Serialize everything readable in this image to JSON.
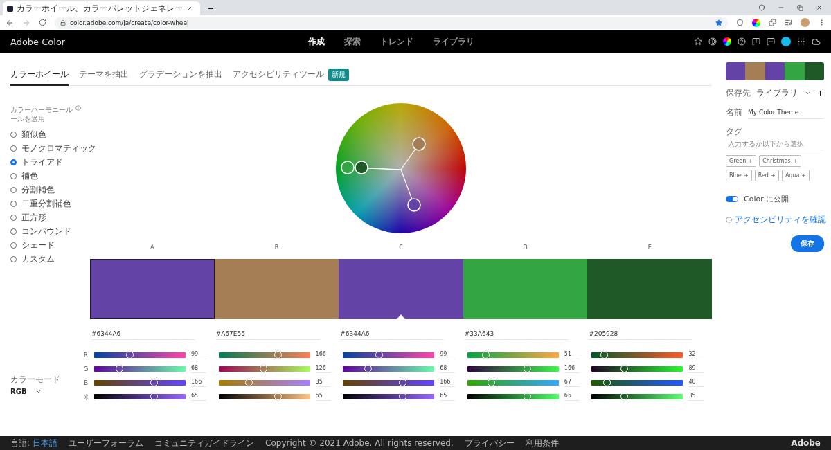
{
  "browser": {
    "tab_title": "カラーホイール、カラーパレットジェネレー",
    "url": "color.adobe.com/ja/create/color-wheel"
  },
  "header": {
    "logo": "Adobe Color",
    "nav": [
      {
        "label": "作成",
        "selected": true
      },
      {
        "label": "探索",
        "selected": false
      },
      {
        "label": "トレンド",
        "selected": false
      },
      {
        "label": "ライブラリ",
        "selected": false
      }
    ]
  },
  "tabs": [
    {
      "label": "カラーホイール",
      "selected": true
    },
    {
      "label": "テーマを抽出",
      "selected": false
    },
    {
      "label": "グラデーションを抽出",
      "selected": false
    },
    {
      "label": "アクセシビリティツール",
      "selected": false,
      "badge": "新規"
    }
  ],
  "harmony": {
    "title_lines": [
      "カラーハーモニール",
      "ールを適用"
    ],
    "options": [
      {
        "label": "類似色",
        "selected": false
      },
      {
        "label": "モノクロマティック",
        "selected": false
      },
      {
        "label": "トライアド",
        "selected": true
      },
      {
        "label": "補色",
        "selected": false
      },
      {
        "label": "分割補色",
        "selected": false
      },
      {
        "label": "二重分割補色",
        "selected": false
      },
      {
        "label": "正方形",
        "selected": false
      },
      {
        "label": "コンパウンド",
        "selected": false
      },
      {
        "label": "シェード",
        "selected": false
      },
      {
        "label": "カスタム",
        "selected": false
      }
    ]
  },
  "color_mode": {
    "label": "カラーモード",
    "value": "RGB"
  },
  "channel_labels": [
    "R",
    "G",
    "B"
  ],
  "swatches": [
    {
      "label": "A",
      "color": "#6344a6",
      "hex": "#6344A6",
      "selected": true,
      "base": false,
      "sliders": [
        {
          "kind": "rgb",
          "level": 0.39,
          "reading": "99"
        },
        {
          "kind": "rgb",
          "level": 0.27,
          "reading": "68"
        },
        {
          "kind": "rgb",
          "level": 0.65,
          "reading": "166"
        },
        {
          "kind": "brightness",
          "level": 0.65,
          "reading": "65"
        }
      ]
    },
    {
      "label": "B",
      "color": "#a67e55",
      "hex": "#A67E55",
      "selected": false,
      "base": false,
      "sliders": [
        {
          "kind": "rgb",
          "level": 0.65,
          "reading": "166"
        },
        {
          "kind": "rgb",
          "level": 0.49,
          "reading": "126"
        },
        {
          "kind": "rgb",
          "level": 0.33,
          "reading": "85"
        },
        {
          "kind": "brightness",
          "level": 0.65,
          "reading": "65"
        }
      ]
    },
    {
      "label": "C",
      "color": "#6344a6",
      "hex": "#6344A6",
      "selected": false,
      "base": true,
      "sliders": [
        {
          "kind": "rgb",
          "level": 0.39,
          "reading": "99"
        },
        {
          "kind": "rgb",
          "level": 0.27,
          "reading": "68"
        },
        {
          "kind": "rgb",
          "level": 0.65,
          "reading": "166"
        },
        {
          "kind": "brightness",
          "level": 0.65,
          "reading": "65"
        }
      ]
    },
    {
      "label": "D",
      "color": "#33a643",
      "hex": "#33A643",
      "selected": false,
      "base": false,
      "sliders": [
        {
          "kind": "rgb",
          "level": 0.2,
          "reading": "51"
        },
        {
          "kind": "rgb",
          "level": 0.65,
          "reading": "166"
        },
        {
          "kind": "rgb",
          "level": 0.26,
          "reading": "67"
        },
        {
          "kind": "brightness",
          "level": 0.65,
          "reading": "65"
        }
      ]
    },
    {
      "label": "E",
      "color": "#205928",
      "hex": "#205928",
      "selected": false,
      "base": false,
      "sliders": [
        {
          "kind": "rgb",
          "level": 0.13,
          "reading": "32"
        },
        {
          "kind": "rgb",
          "level": 0.35,
          "reading": "89"
        },
        {
          "kind": "rgb",
          "level": 0.16,
          "reading": "40"
        },
        {
          "kind": "brightness",
          "level": 0.35,
          "reading": "35"
        }
      ]
    }
  ],
  "panel": {
    "save_to": {
      "label": "保存先",
      "value": "ライブラリ"
    },
    "name": {
      "label": "名前",
      "value": "My Color Theme"
    },
    "tags": {
      "label": "タグ",
      "placeholder": "入力するか以下から選択",
      "chips": [
        "Green",
        "Christmas",
        "Blue",
        "Red",
        "Aqua"
      ]
    },
    "publish": {
      "label": "Color に公開",
      "on": true
    },
    "accessibility_link": "アクセシビリティを確認",
    "save_button": "保存"
  },
  "footer": {
    "language_label": "言語:",
    "language": "日本語",
    "links_left": [
      "ユーザーフォーラム",
      "コミュニティガイドライン"
    ],
    "copyright": "Copyright © 2021 Adobe. All rights reserved.",
    "links_right": [
      "プライバシー",
      "利用条件"
    ],
    "brand": "Adobe"
  }
}
